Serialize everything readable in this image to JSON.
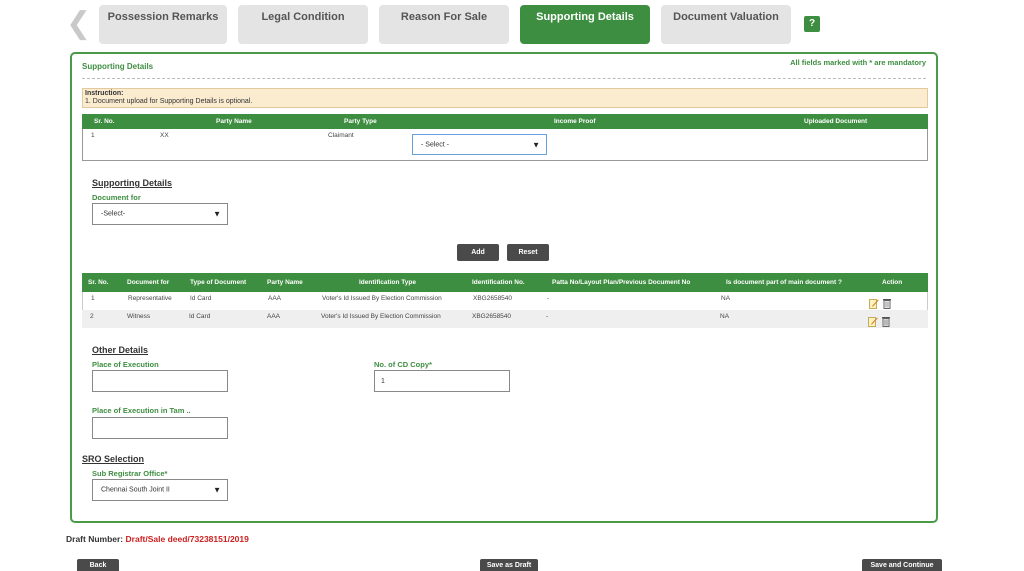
{
  "tabs": [
    {
      "label": "Possession Remarks"
    },
    {
      "label": "Legal Condition"
    },
    {
      "label": "Reason For Sale"
    },
    {
      "label": "Supporting Details"
    },
    {
      "label": "Document Valuation"
    }
  ],
  "help_label": "?",
  "panel": {
    "title": "Supporting Details",
    "mandatory_note": "All fields marked with * are mandatory",
    "instruction_title": "Instruction:",
    "instruction_text": "1. Document upload for Supporting Details is optional."
  },
  "party_table": {
    "headers": [
      "Sr. No.",
      "Party Name",
      "Party Type",
      "Income Proof",
      "Uploaded Document"
    ],
    "rows": [
      {
        "sr": "1",
        "party_name": "XX",
        "party_type": "Claimant",
        "income_proof": "- Select -"
      }
    ]
  },
  "supporting_form": {
    "heading": "Supporting Details",
    "document_for_label": "Document for",
    "document_for_value": "-Select-",
    "add_label": "Add",
    "reset_label": "Reset"
  },
  "doc_table": {
    "headers": [
      "Sr. No.",
      "Document for",
      "Type of Document",
      "Party Name",
      "Identification Type",
      "Identification No.",
      "Patta No/Layout Plan/Previous Document No",
      "Is document part of main document ?",
      "Action"
    ],
    "rows": [
      {
        "sr": "1",
        "doc_for": "Representative",
        "type": "Id Card",
        "party": "AAA",
        "id_type": "Voter's Id Issued By Election Commission",
        "id_no": "XBG2658540",
        "patta": "-",
        "part_of_main": "NA"
      },
      {
        "sr": "2",
        "doc_for": "Witness",
        "type": "Id Card",
        "party": "AAA",
        "id_type": "Voter's Id Issued By Election Commission",
        "id_no": "XBG2658540",
        "patta": "-",
        "part_of_main": "NA"
      }
    ]
  },
  "other_details": {
    "heading": "Other Details",
    "place_label": "Place of Execution",
    "place_value": "",
    "cd_copy_label": "No. of CD Copy*",
    "cd_copy_value": "1",
    "place_tamil_label": "Place of Execution in Tam ..",
    "place_tamil_value": ""
  },
  "sro": {
    "heading": "SRO Selection",
    "label": "Sub Registrar Office*",
    "value": "Chennai South Joint II"
  },
  "draft": {
    "label": "Draft Number:",
    "value": "Draft/Sale deed/73238151/2019"
  },
  "footer": {
    "back_label": "Back",
    "save_draft_label": "Save as Draft",
    "save_continue_label": "Save and Continue"
  },
  "colors": {
    "accent": "#3e8e41",
    "draft_red": "#cc1f1f",
    "instruction_bg": "#fbecd0"
  }
}
